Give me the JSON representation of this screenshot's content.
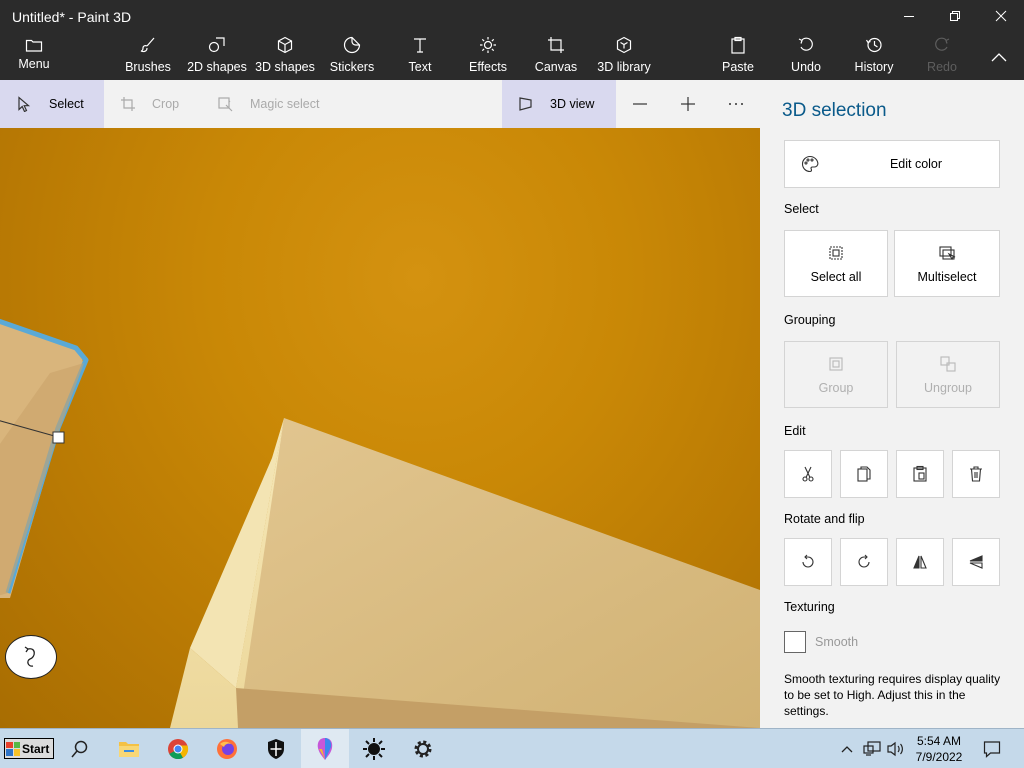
{
  "window": {
    "title": "Untitled* - Paint 3D"
  },
  "window_controls": [
    "minimize-icon",
    "restore-icon",
    "close-icon"
  ],
  "toolbar": {
    "menu": "Menu",
    "brushes": "Brushes",
    "shapes_2d": "2D shapes",
    "shapes_3d": "3D shapes",
    "stickers": "Stickers",
    "text": "Text",
    "effects": "Effects",
    "canvas": "Canvas",
    "library_3d": "3D library",
    "paste": "Paste",
    "undo": "Undo",
    "history": "History",
    "redo": "Redo"
  },
  "subtoolbar": {
    "select": "Select",
    "crop": "Crop",
    "magic_select": "Magic select",
    "view_3d": "3D view"
  },
  "panel": {
    "title": "3D selection",
    "edit_color": "Edit color",
    "select_heading": "Select",
    "select_all": "Select all",
    "multiselect": "Multiselect",
    "grouping_heading": "Grouping",
    "group": "Group",
    "ungroup": "Ungroup",
    "edit_heading": "Edit",
    "rotate_heading": "Rotate and flip",
    "texturing_heading": "Texturing",
    "smooth": "Smooth",
    "smooth_checked": false,
    "smooth_note": "Smooth texturing requires display quality to be set to High. Adjust this in the settings."
  },
  "taskbar": {
    "start": "Start",
    "time": "5:54 AM",
    "date": "7/9/2022"
  },
  "colors": {
    "titlebar": "#2b2b2b",
    "accent_title": "#0a5a8a",
    "selection_outline": "#5aa9d6",
    "canvas": "#c98806",
    "taskbar": "#c5d9ea"
  }
}
